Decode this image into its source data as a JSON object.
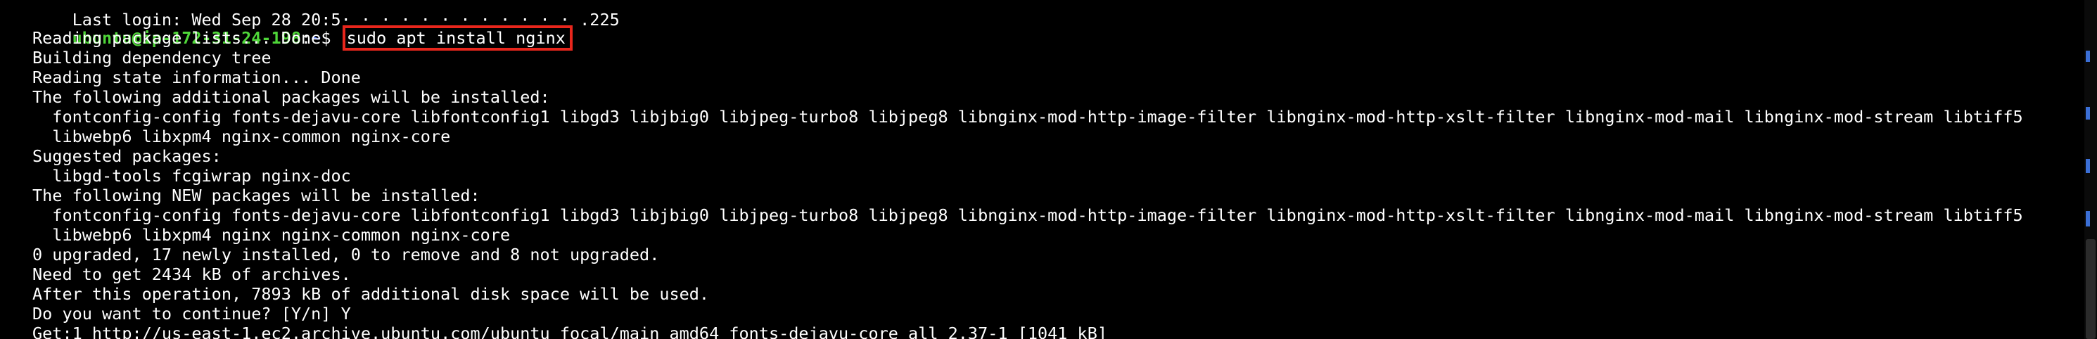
{
  "terminal": {
    "last_login": "Last login: Wed Sep 28 20:5· · · · · · · · · · · · .225",
    "prompt": {
      "user_host": "ubuntu@ip-172-31-24-198",
      "separator": ":",
      "path": "~",
      "symbol": "$ ",
      "command": "sudo apt install nginx"
    },
    "output": [
      "Reading package lists... Done",
      "Building dependency tree",
      "Reading state information... Done",
      "The following additional packages will be installed:",
      "  fontconfig-config fonts-dejavu-core libfontconfig1 libgd3 libjbig0 libjpeg-turbo8 libjpeg8 libnginx-mod-http-image-filter libnginx-mod-http-xslt-filter libnginx-mod-mail libnginx-mod-stream libtiff5",
      "  libwebp6 libxpm4 nginx-common nginx-core",
      "Suggested packages:",
      "  libgd-tools fcgiwrap nginx-doc",
      "The following NEW packages will be installed:",
      "  fontconfig-config fonts-dejavu-core libfontconfig1 libgd3 libjbig0 libjpeg-turbo8 libjpeg8 libnginx-mod-http-image-filter libnginx-mod-http-xslt-filter libnginx-mod-mail libnginx-mod-stream libtiff5",
      "  libwebp6 libxpm4 nginx nginx-common nginx-core",
      "0 upgraded, 17 newly installed, 0 to remove and 8 not upgraded.",
      "Need to get 2434 kB of archives.",
      "After this operation, 7893 kB of additional disk space will be used.",
      "Do you want to continue? [Y/n] Y",
      "Get:1 http://us-east-1.ec2.archive.ubuntu.com/ubuntu focal/main amd64 fonts-dejavu-core all 2.37-1 [1041 kB]"
    ]
  },
  "colors": {
    "background": "#000000",
    "text": "#ffffff",
    "prompt_user": "#4fd639",
    "prompt_path": "#5a7dff",
    "highlight_box": "#e8261c"
  }
}
